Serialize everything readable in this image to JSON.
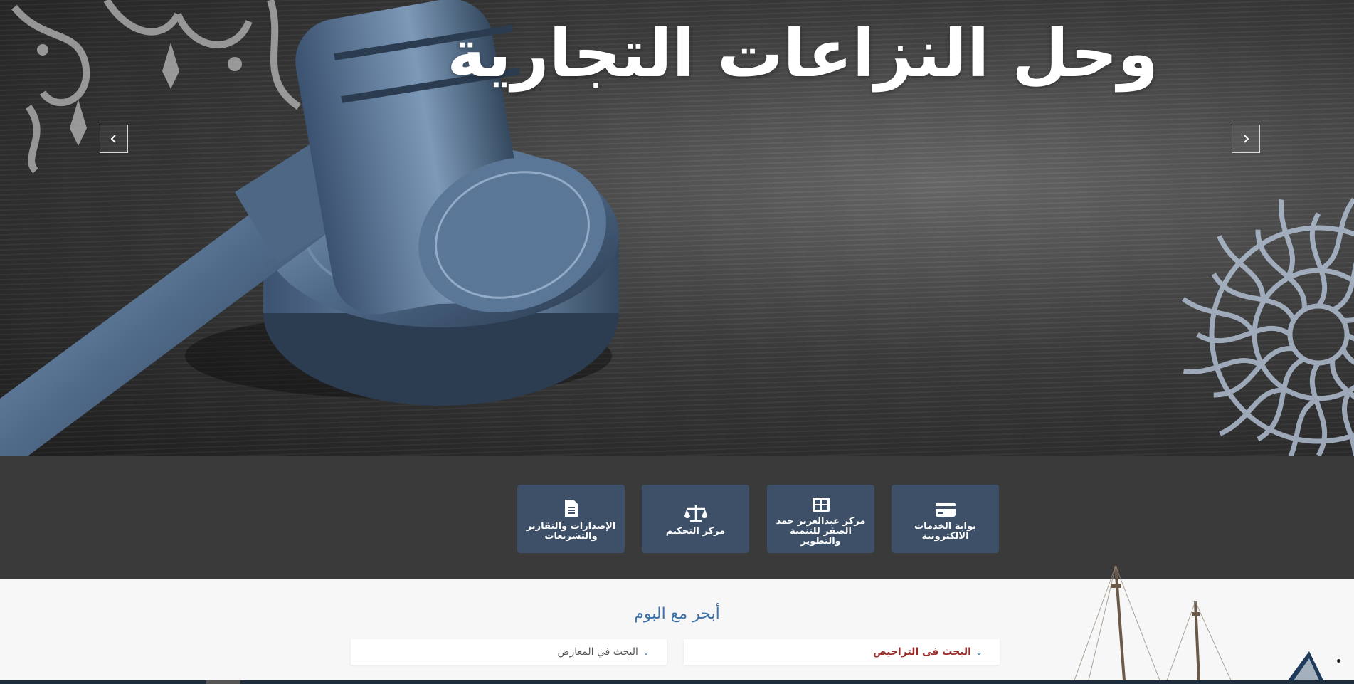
{
  "hero": {
    "title": "وحل النزاعات التجارية",
    "prev_icon": "chevron-left-icon",
    "next_icon": "chevron-right-icon"
  },
  "quick_links": [
    {
      "label": "بوابة الخدمات الالكترونية",
      "icon": "credit-card-icon"
    },
    {
      "label": "مركز عبدالعزيز حمد الصقر للتنمية والتطوير",
      "icon": "table-icon"
    },
    {
      "label": "مركز التحكيم",
      "icon": "balance-scale-icon"
    },
    {
      "label": "الإصدارات والتقارير والتشريعات",
      "icon": "document-icon"
    }
  ],
  "search": {
    "title": "أبحر مع البوم",
    "licenses_label": "البحث فى التراخيص",
    "exhibits_label": "البحث في المعارض",
    "chevron_icon": "chevron-down-icon"
  },
  "colors": {
    "card_bg": "#3d5068",
    "band_bg": "#3a3a3a",
    "title_blue": "#3f72a8",
    "license_red": "#9b2c2c"
  }
}
